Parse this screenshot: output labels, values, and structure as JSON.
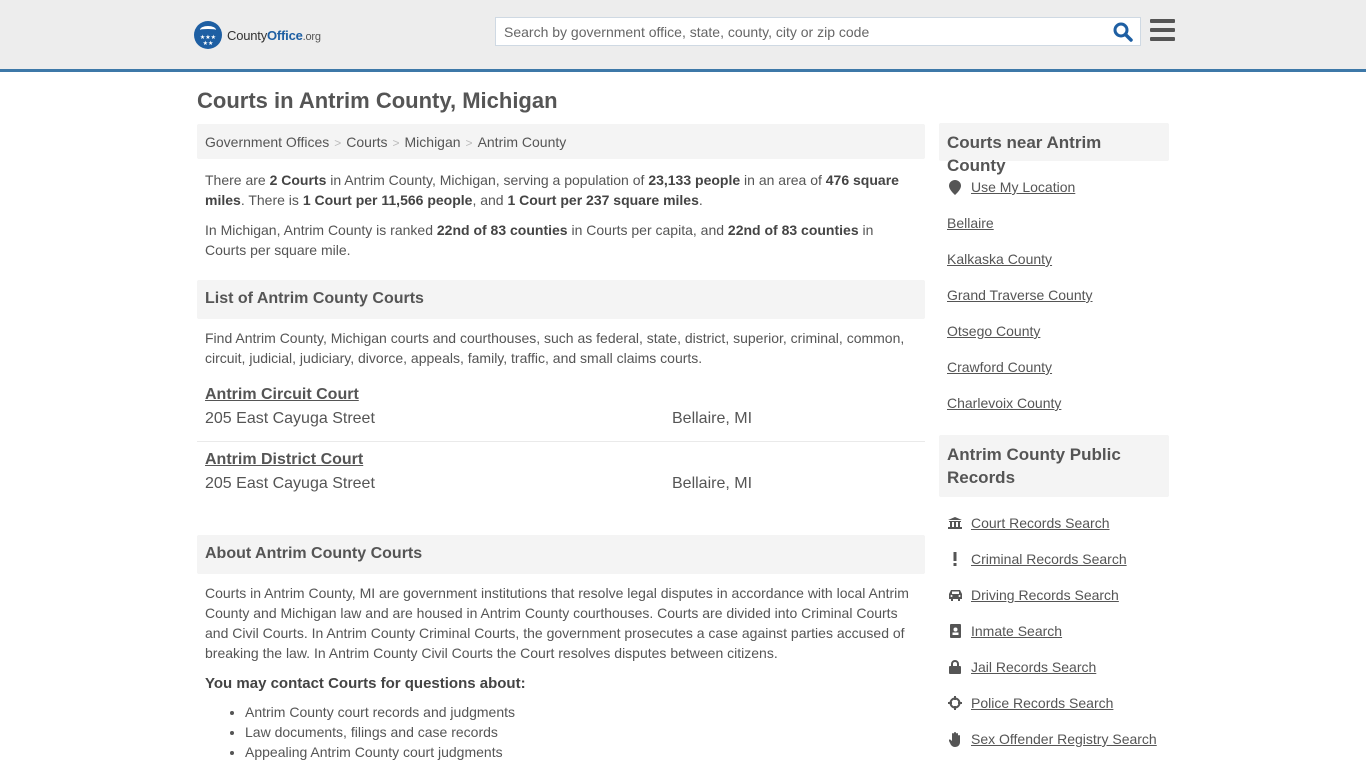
{
  "header": {
    "logo": {
      "prefix": "County",
      "brand": "Office",
      "suffix": ".org"
    },
    "search_placeholder": "Search by government office, state, county, city or zip code",
    "search_value": "",
    "brand_color": "#1e5fa3",
    "accent_line_color": "#3d78a8"
  },
  "page": {
    "title": "Courts in Antrim County, Michigan"
  },
  "breadcrumb": [
    "Government Offices",
    "Courts",
    "Michigan",
    "Antrim County"
  ],
  "summary": {
    "p1": [
      {
        "t": "There are ",
        "b": false
      },
      {
        "t": "2 Courts",
        "b": true
      },
      {
        "t": " in Antrim County, Michigan, serving a population of ",
        "b": false
      },
      {
        "t": "23,133 people",
        "b": true
      },
      {
        "t": " in an area of ",
        "b": false
      },
      {
        "t": "476 square miles",
        "b": true
      },
      {
        "t": ". There is ",
        "b": false
      },
      {
        "t": "1 Court per 11,566 people",
        "b": true
      },
      {
        "t": ", and ",
        "b": false
      },
      {
        "t": "1 Court per 237 square miles",
        "b": true
      },
      {
        "t": ".",
        "b": false
      }
    ],
    "p2": [
      {
        "t": "In Michigan, Antrim County is ranked ",
        "b": false
      },
      {
        "t": "22nd of 83 counties",
        "b": true
      },
      {
        "t": " in Courts per capita, and ",
        "b": false
      },
      {
        "t": "22nd of 83 counties",
        "b": true
      },
      {
        "t": " in Courts per square mile.",
        "b": false
      }
    ]
  },
  "list_section": {
    "heading": "List of Antrim County Courts",
    "intro": "Find Antrim County, Michigan courts and courthouses, such as federal, state, district, superior, criminal, common, circuit, judicial, judiciary, divorce, appeals, family, traffic, and small claims courts.",
    "courts": [
      {
        "name": "Antrim Circuit Court",
        "address": "205 East Cayuga Street",
        "city": "Bellaire, MI"
      },
      {
        "name": "Antrim District Court",
        "address": "205 East Cayuga Street",
        "city": "Bellaire, MI"
      }
    ]
  },
  "about_section": {
    "heading": "About Antrim County Courts",
    "body": "Courts in Antrim County, MI are government institutions that resolve legal disputes in accordance with local Antrim County and Michigan law and are housed in Antrim County courthouses. Courts are divided into Criminal Courts and Civil Courts. In Antrim County Criminal Courts, the government prosecutes a case against parties accused of breaking the law. In Antrim County Civil Courts the Court resolves disputes between citizens.",
    "contact_heading": "You may contact Courts for questions about:",
    "bullets": [
      "Antrim County court records and judgments",
      "Law documents, filings and case records",
      "Appealing Antrim County court judgments"
    ]
  },
  "sidebar": {
    "near_heading": "Courts near Antrim County",
    "use_location": {
      "label": "Use My Location",
      "icon": "map-marker-icon"
    },
    "near_links": [
      "Bellaire",
      "Kalkaska County",
      "Grand Traverse County",
      "Otsego County",
      "Crawford County",
      "Charlevoix County"
    ],
    "records_heading": "Antrim County Public Records",
    "records_links": [
      {
        "label": "Court Records Search",
        "icon": "courthouse-icon"
      },
      {
        "label": "Criminal Records Search",
        "icon": "exclamation-icon"
      },
      {
        "label": "Driving Records Search",
        "icon": "car-icon"
      },
      {
        "label": "Inmate Search",
        "icon": "id-badge-icon"
      },
      {
        "label": "Jail Records Search",
        "icon": "lock-icon"
      },
      {
        "label": "Police Records Search",
        "icon": "crosshairs-icon"
      },
      {
        "label": "Sex Offender Registry Search",
        "icon": "hand-icon"
      }
    ]
  }
}
